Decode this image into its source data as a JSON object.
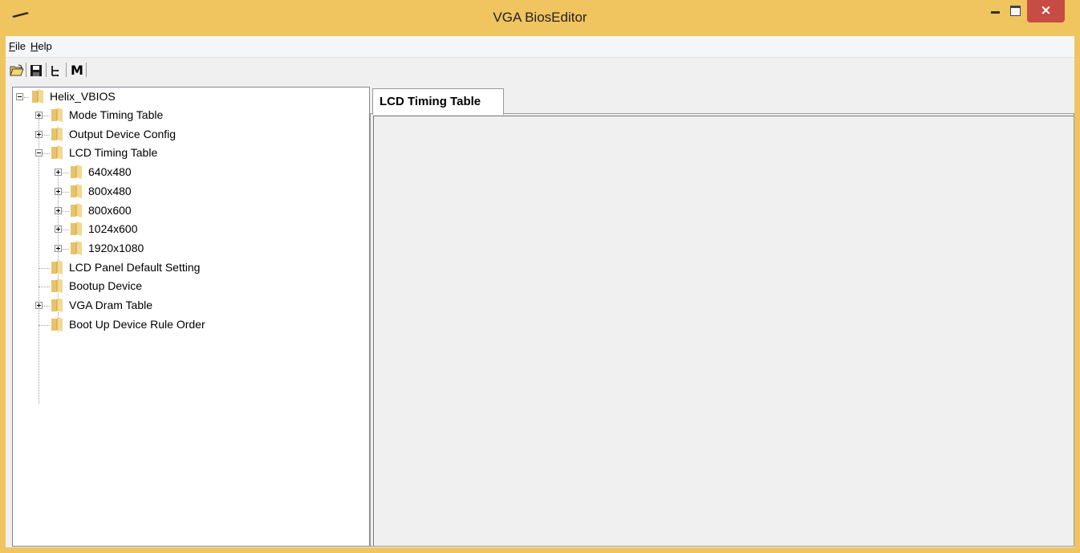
{
  "window": {
    "title": "VGA BiosEditor",
    "close_glyph": "×",
    "accent_color": "#f0c45f",
    "close_color": "#c74c43"
  },
  "menu": {
    "file": {
      "mnemonic": "F",
      "rest": "ile"
    },
    "help": {
      "mnemonic": "H",
      "rest": "elp"
    }
  },
  "toolbar": {
    "icons": [
      "open-folder-icon",
      "save-icon",
      "tree-view-icon",
      "m-icon"
    ],
    "m_label": "M"
  },
  "tree": {
    "root": "Helix_VBIOS",
    "items": [
      {
        "label": "Mode Timing Table",
        "expander": "plus"
      },
      {
        "label": "Output Device Config",
        "expander": "plus"
      },
      {
        "label": "LCD Timing Table",
        "expander": "minus"
      },
      {
        "label": "640x480",
        "expander": "plus"
      },
      {
        "label": "800x480",
        "expander": "plus"
      },
      {
        "label": "800x600",
        "expander": "plus"
      },
      {
        "label": "1024x600",
        "expander": "plus"
      },
      {
        "label": "1920x1080",
        "expander": "plus"
      },
      {
        "label": "LCD Panel Default Setting",
        "expander": "none"
      },
      {
        "label": "Bootup Device",
        "expander": "none"
      },
      {
        "label": "VGA Dram Table",
        "expander": "plus"
      },
      {
        "label": "Boot Up Device Rule Order",
        "expander": "none"
      }
    ]
  },
  "tabs": {
    "active": "LCD Timing Table"
  }
}
